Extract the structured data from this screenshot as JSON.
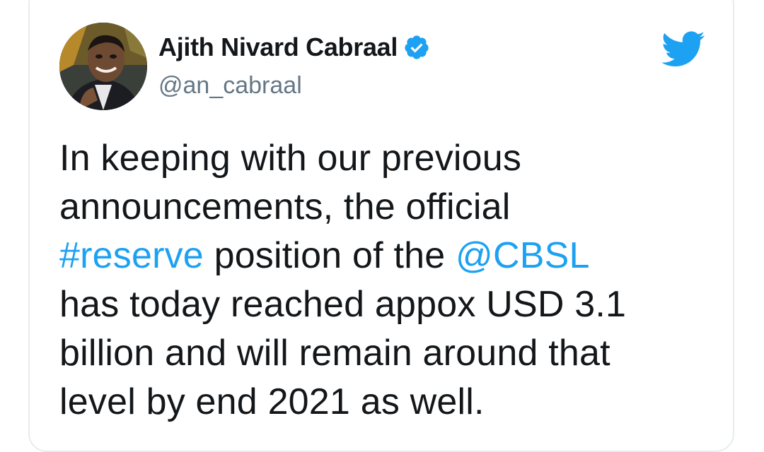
{
  "author": {
    "display_name": "Ajith Nivard Cabraal",
    "handle": "@an_cabraal",
    "verified": true
  },
  "tweet": {
    "line1": "In keeping with our previous",
    "line2": "announcements, the official",
    "line3_hashtag": "#reserve",
    "line3_text": " position of the ",
    "line3_mention": "@CBSL",
    "line4": "has today reached appox USD 3.1",
    "line5": "billion and will remain around that",
    "line6": "level by end 2021 as well."
  },
  "icons": {
    "brand": "twitter-bird-icon",
    "verified": "verified-badge-icon"
  },
  "colors": {
    "accent": "#1da1f2",
    "text": "#14171a",
    "secondary": "#657786",
    "border": "#e6ecf0"
  }
}
